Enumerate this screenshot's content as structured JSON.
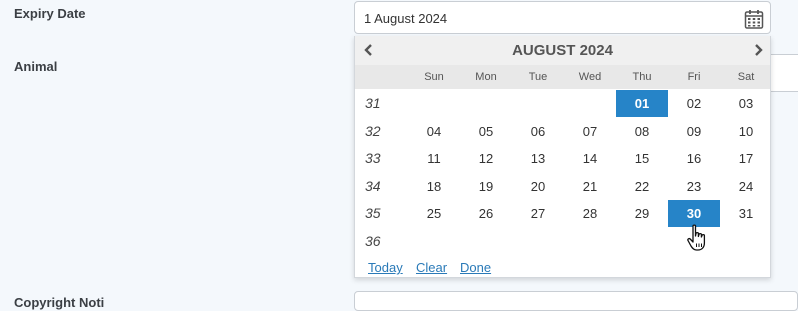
{
  "form": {
    "expiry_label": "Expiry Date",
    "animal_label": "Animal",
    "copyright_label": "Copyright Noti",
    "expiry_value": "1 August 2024",
    "calendar_icon": "calendar-icon"
  },
  "datepicker": {
    "title": "AUGUST 2024",
    "prev_icon": "chevron-left-icon",
    "next_icon": "chevron-right-icon",
    "days_of_week": [
      "Sun",
      "Mon",
      "Tue",
      "Wed",
      "Thu",
      "Fri",
      "Sat"
    ],
    "weeks": [
      {
        "week": "31",
        "days": [
          "",
          "",
          "",
          "",
          "01",
          "02",
          "03"
        ]
      },
      {
        "week": "32",
        "days": [
          "04",
          "05",
          "06",
          "07",
          "08",
          "09",
          "10"
        ]
      },
      {
        "week": "33",
        "days": [
          "11",
          "12",
          "13",
          "14",
          "15",
          "16",
          "17"
        ]
      },
      {
        "week": "34",
        "days": [
          "18",
          "19",
          "20",
          "21",
          "22",
          "23",
          "24"
        ]
      },
      {
        "week": "35",
        "days": [
          "25",
          "26",
          "27",
          "28",
          "29",
          "30",
          "31"
        ]
      },
      {
        "week": "36",
        "days": [
          "",
          "",
          "",
          "",
          "",
          "",
          ""
        ]
      }
    ],
    "selected_days": [
      "01",
      "30"
    ],
    "buttons": {
      "today": "Today",
      "clear": "Clear",
      "done": "Done"
    },
    "colors": {
      "selected": "#2684c8",
      "link": "#2a7ab8"
    }
  }
}
